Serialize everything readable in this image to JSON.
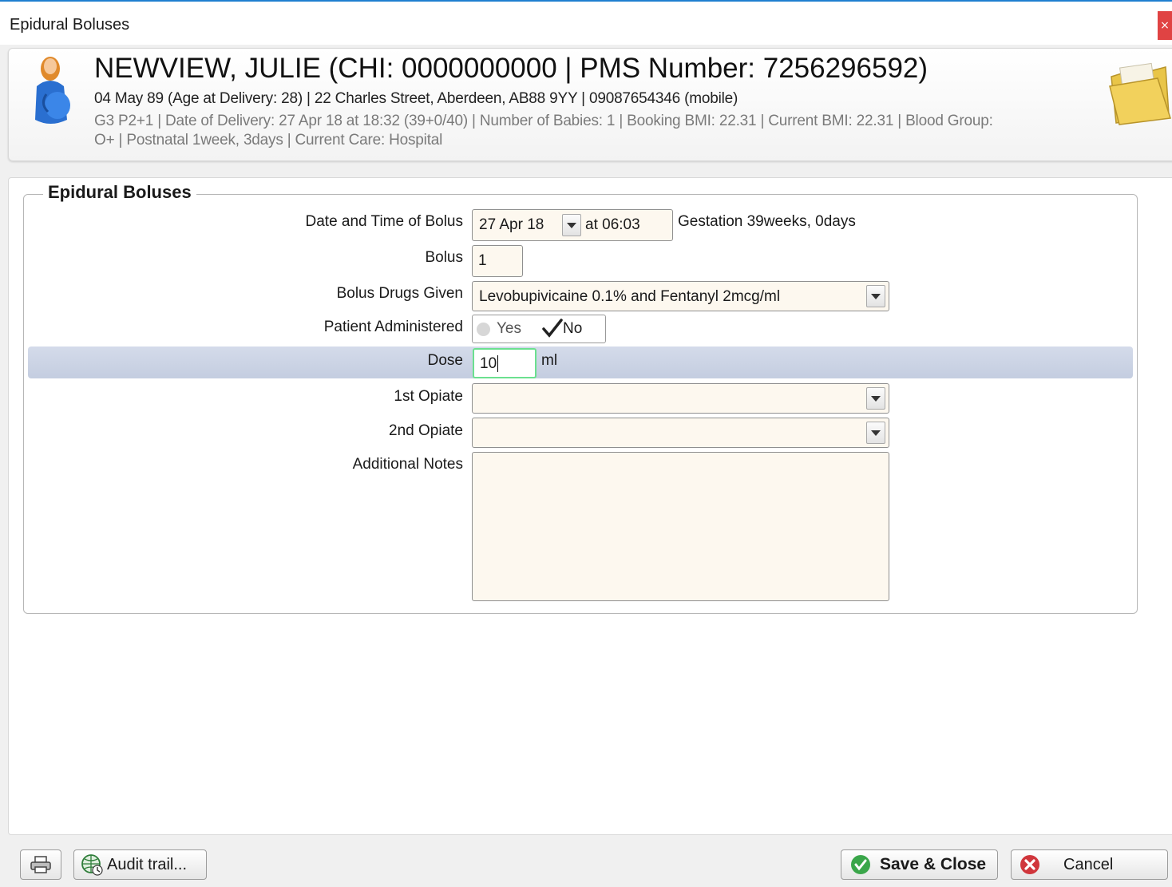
{
  "window": {
    "title": "Epidural Boluses",
    "close_glyph": "×"
  },
  "patient": {
    "name_line": "NEWVIEW, JULIE (CHI: 0000000000 | PMS Number: 7256296592)",
    "demographics": "04 May 89 (Age at Delivery: 28) | 22 Charles Street, Aberdeen, AB88 9YY | 09087654346 (mobile)",
    "pregnancy_line1": "G3 P2+1  | Date of Delivery: 27 Apr 18 at 18:32 (39+0/40) | Number of Babies: 1 | Booking BMI: 22.31 | Current BMI: 22.31 | Blood Group:",
    "pregnancy_line2": "O+ | Postnatal 1week, 3days | Current Care: Hospital",
    "icons": {
      "avatar": "pregnant-patient-icon",
      "folder": "folder-icon"
    }
  },
  "form": {
    "legend": "Epidural Boluses",
    "date_time": {
      "label": "Date and Time of Bolus",
      "date": "27 Apr 18",
      "time": "at 06:03",
      "gestation": "Gestation 39weeks, 0days"
    },
    "bolus": {
      "label": "Bolus",
      "value": "1"
    },
    "bolus_drugs": {
      "label": "Bolus Drugs Given",
      "value": "Levobupivicaine 0.1% and Fentanyl 2mcg/ml"
    },
    "patient_administered": {
      "label": "Patient Administered",
      "yes": "Yes",
      "no": "No",
      "selected": "No"
    },
    "dose": {
      "label": "Dose",
      "value": "10",
      "unit": "ml"
    },
    "opiate1": {
      "label": "1st Opiate",
      "value": ""
    },
    "opiate2": {
      "label": "2nd Opiate",
      "value": ""
    },
    "notes": {
      "label": "Additional Notes",
      "value": ""
    }
  },
  "footer": {
    "print_icon": "printer-icon",
    "audit_label": "Audit trail...",
    "save_label": "Save & Close",
    "cancel_label": "Cancel"
  },
  "colors": {
    "accent": "#1e7fd0",
    "input_bg": "#fdf8ef",
    "highlight": "#c9d2e4",
    "save_green": "#3aa64a",
    "cancel_red": "#d0363c"
  }
}
